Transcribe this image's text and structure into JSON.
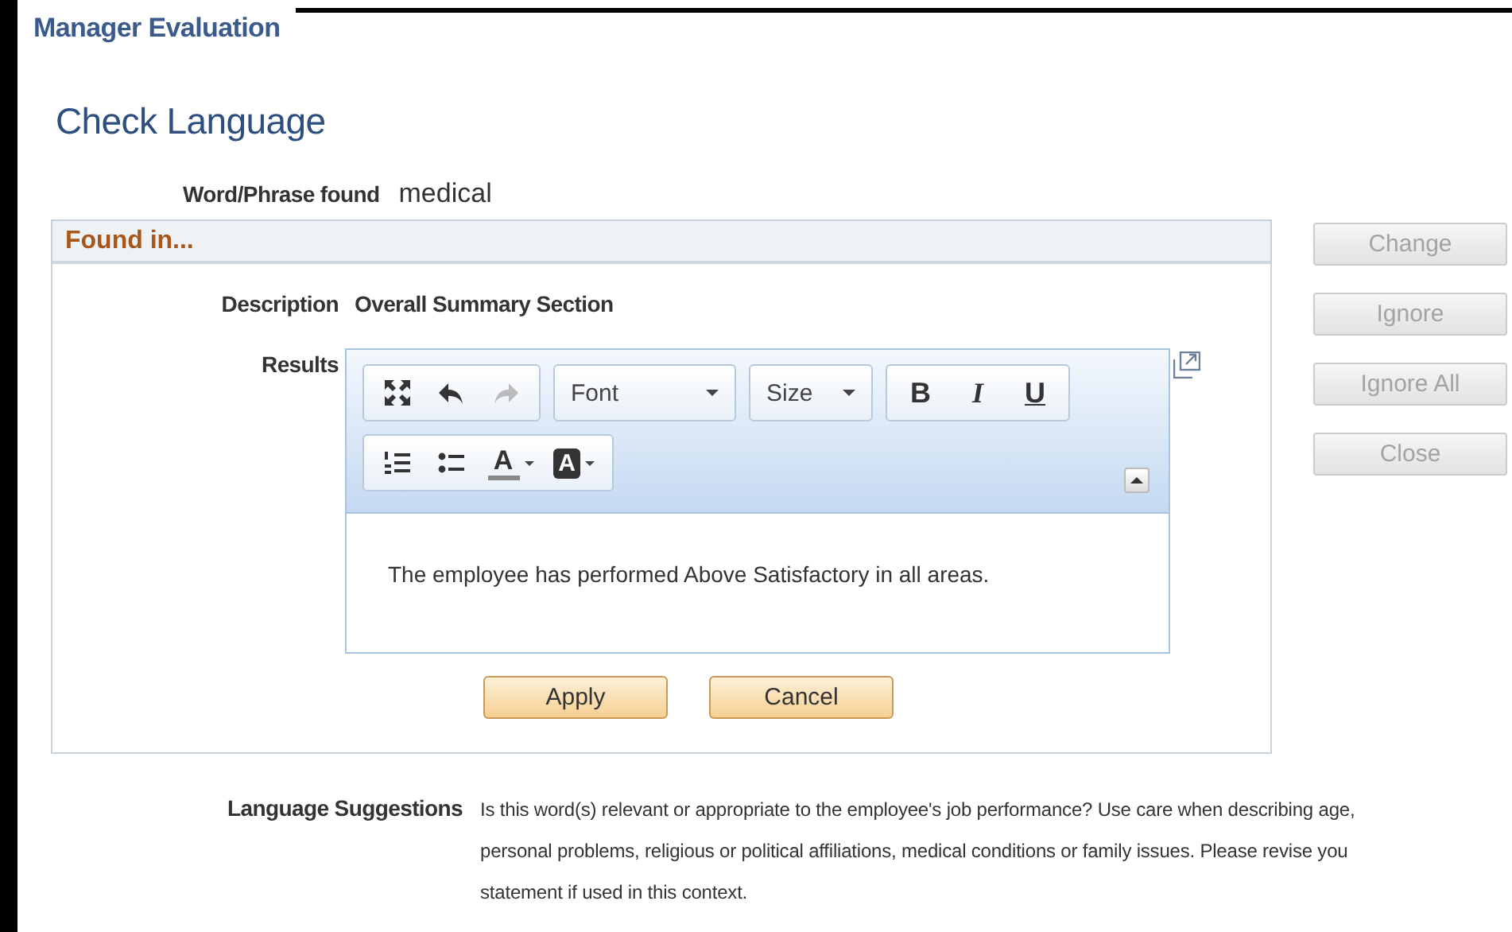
{
  "header": {
    "title": "Manager Evaluation"
  },
  "page_title": "Check Language",
  "word_found": {
    "label": "Word/Phrase found",
    "value": "medical"
  },
  "found_in": {
    "title": "Found in...",
    "description": {
      "label": "Description",
      "value": "Overall Summary Section"
    },
    "results": {
      "label": "Results",
      "editor": {
        "history": [
          {
            "kind": "undo",
            "disabled": false
          },
          {
            "kind": "redo",
            "disabled": true
          }
        ],
        "font": "Font",
        "size": "Size",
        "bold": "B",
        "italic": "I",
        "underline": "U",
        "text_color": "A",
        "background_color": "A",
        "content": "The employee has performed Above Satisfactory in all areas."
      },
      "buttons": [
        {
          "label": "Apply"
        },
        {
          "label": "Cancel"
        }
      ]
    }
  },
  "actions": [
    {
      "label": "Change",
      "disabled": true
    },
    {
      "label": "Ignore",
      "disabled": true
    },
    {
      "label": "Ignore All",
      "disabled": true
    },
    {
      "label": "Close",
      "disabled": true
    }
  ],
  "suggestions": {
    "label": "Language Suggestions",
    "lines": [
      "Is this word(s) relevant or appropriate to the employee's job performance? Use care when describing age,",
      "personal problems, religious or political affiliations, medical conditions or family issues. Please revise you",
      "statement if used in this context."
    ]
  }
}
